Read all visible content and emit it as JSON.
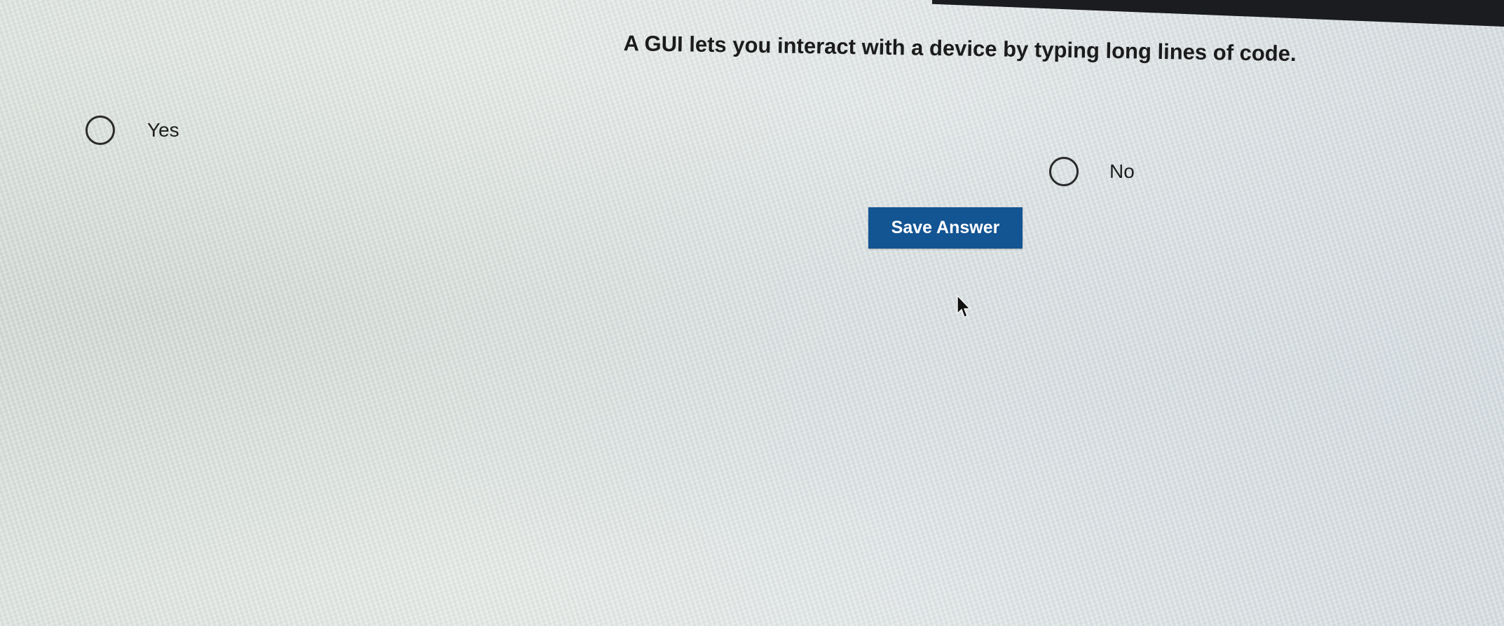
{
  "question": {
    "text": "A GUI lets you interact with a device by typing long lines of code."
  },
  "options": [
    {
      "label": "Yes",
      "selected": false
    },
    {
      "label": "No",
      "selected": false
    }
  ],
  "actions": {
    "save_label": "Save Answer"
  },
  "colors": {
    "button_background": "#135493",
    "button_text": "#ffffff",
    "screen_background": "#e3e8e5"
  },
  "icons": {
    "pointer": "mouse-pointer-icon",
    "radio": "radio-button-icon"
  }
}
